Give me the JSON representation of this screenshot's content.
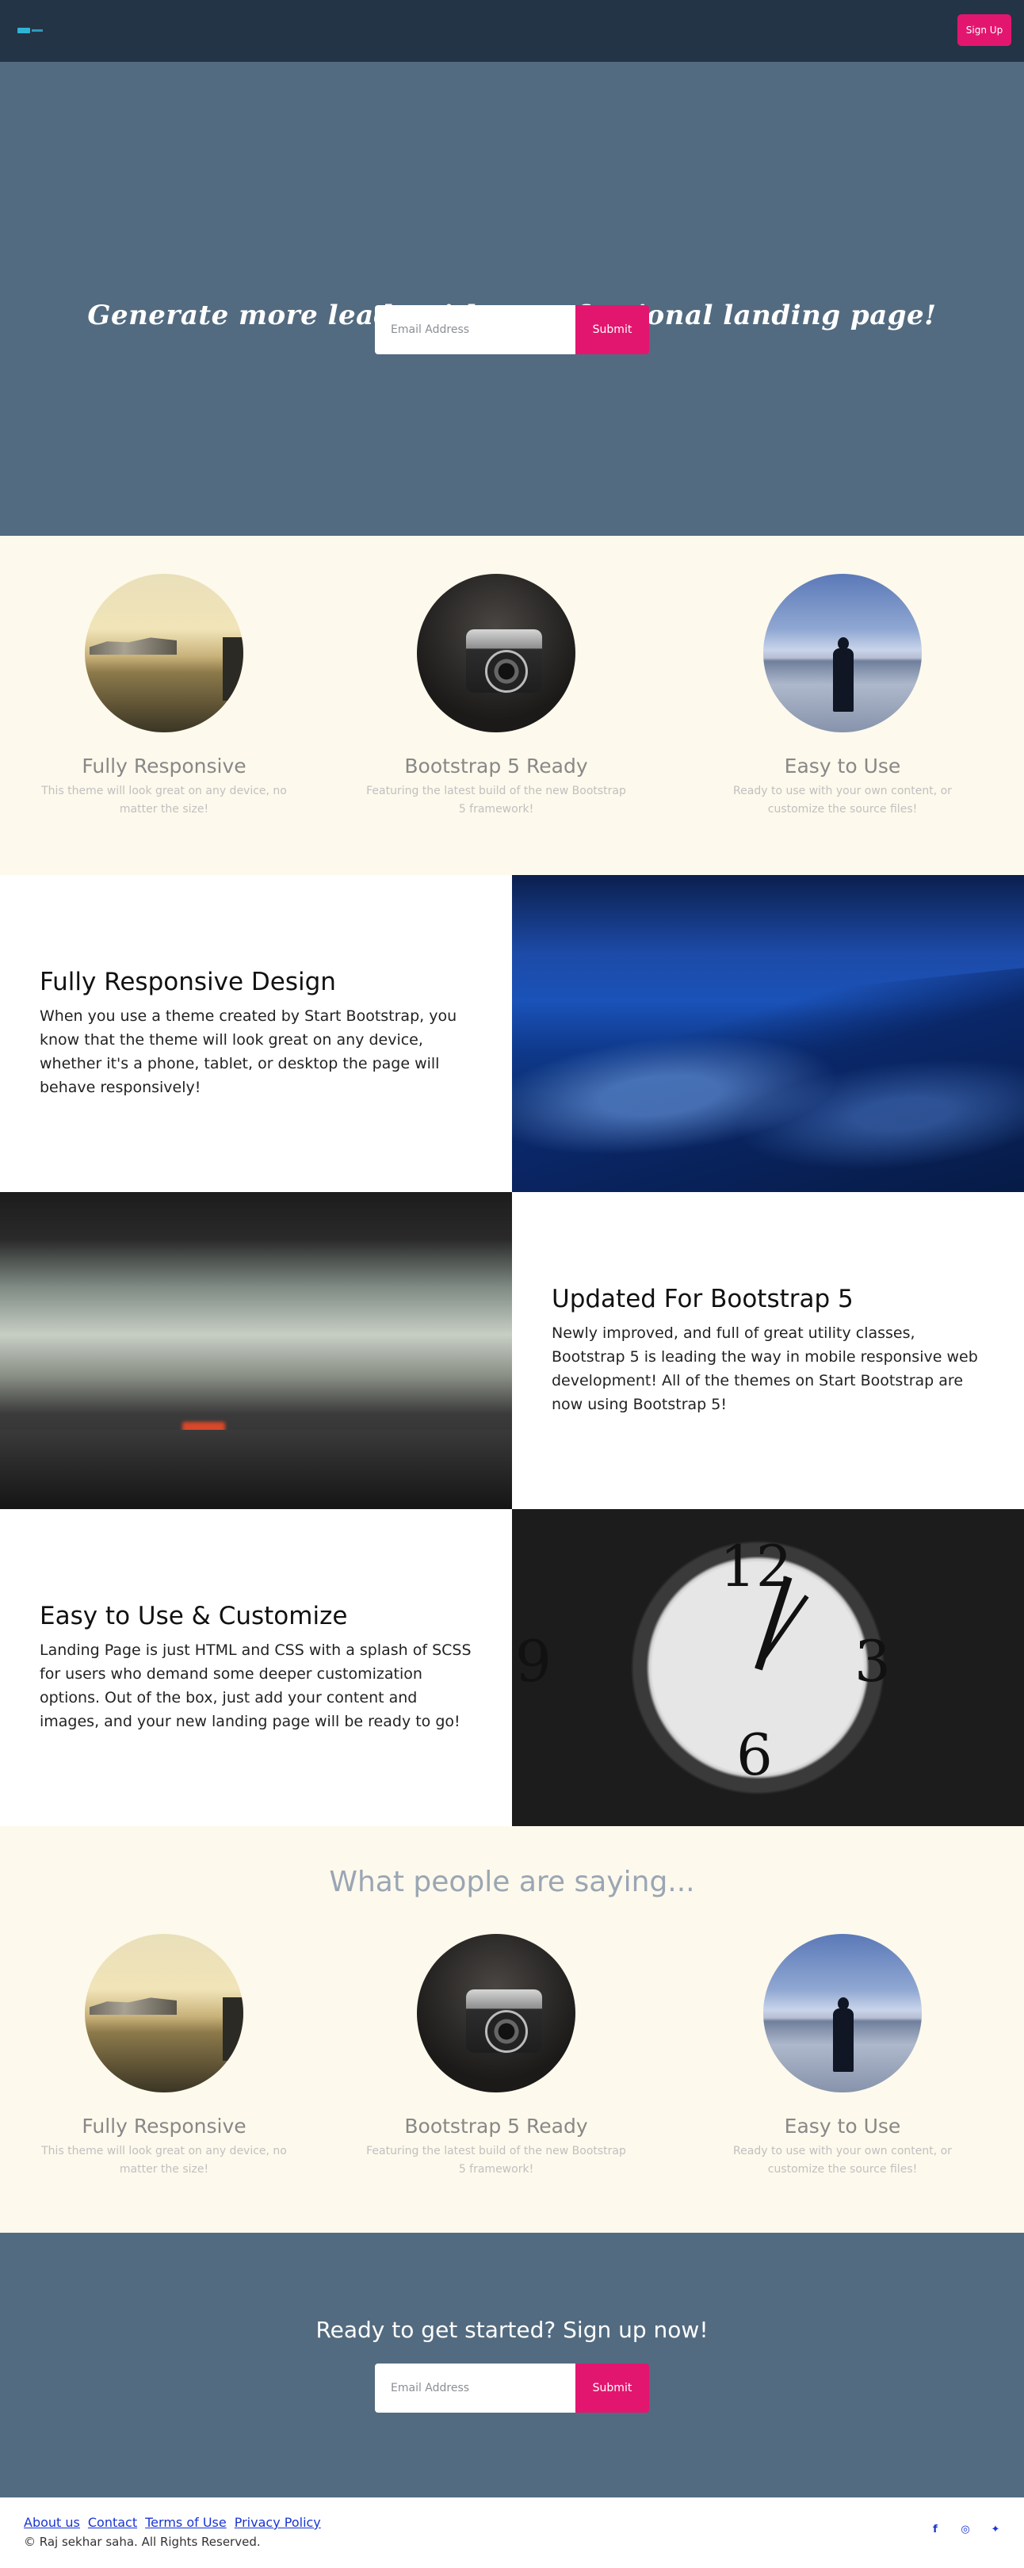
{
  "navbar": {
    "signup_label": "Sign Up"
  },
  "hero": {
    "title": "Generate more leads with a professional landing page!",
    "email_placeholder": "Email Address",
    "submit_label": "Submit"
  },
  "features": [
    {
      "title": "Fully Responsive",
      "text": "This theme will look great on any device, no matter the size!",
      "image": "harbor-photo"
    },
    {
      "title": "Bootstrap 5 Ready",
      "text": "Featuring the latest build of the new Bootstrap 5 framework!",
      "image": "camera-photo"
    },
    {
      "title": "Easy to Use",
      "text": "Ready to use with your own content, or customize the source files!",
      "image": "lake-person-photo"
    }
  ],
  "showcase": [
    {
      "title": "Fully Responsive Design",
      "text": "When you use a theme created by Start Bootstrap, you know that the theme will look great on any device, whether it's a phone, tablet, or desktop the page will behave responsively!",
      "image": "blue-shore-photo"
    },
    {
      "title": "Updated For Bootstrap 5",
      "text": "Newly improved, and full of great utility classes, Bootstrap 5 is leading the way in mobile responsive web development! All of the themes on Start Bootstrap are now using Bootstrap 5!",
      "image": "blurred-street-photo"
    },
    {
      "title": "Easy to Use & Customize",
      "text": "Landing Page is just HTML and CSS with a splash of SCSS for users who demand some deeper customization options. Out of the box, just add your content and images, and your new landing page will be ready to go!",
      "image": "clock-photo"
    }
  ],
  "testimonials": {
    "heading": "What people are saying...",
    "items": [
      {
        "title": "Fully Responsive",
        "text": "This theme will look great on any device, no matter the size!",
        "image": "harbor-photo"
      },
      {
        "title": "Bootstrap 5 Ready",
        "text": "Featuring the latest build of the new Bootstrap 5 framework!",
        "image": "camera-photo"
      },
      {
        "title": "Easy to Use",
        "text": "Ready to use with your own content, or customize the source files!",
        "image": "lake-person-photo"
      }
    ]
  },
  "cta": {
    "title": "Ready to get started? Sign up now!",
    "email_placeholder": "Email Address",
    "submit_label": "Submit"
  },
  "footer": {
    "links": [
      "About us",
      "Contact",
      "Terms of Use",
      "Privacy Policy"
    ],
    "copyright": "© Raj sekhar saha. All Rights Reserved.",
    "social": [
      {
        "icon": "facebook-icon",
        "glyph": "f"
      },
      {
        "icon": "instagram-icon",
        "glyph": "◎"
      },
      {
        "icon": "twitter-icon",
        "glyph": "✦"
      }
    ]
  },
  "colors": {
    "navbar_bg": "#243447",
    "hero_bg": "#536b80",
    "accent": "#e3166f",
    "cream_bg": "#fdf9ec",
    "link": "#1a34d1"
  }
}
